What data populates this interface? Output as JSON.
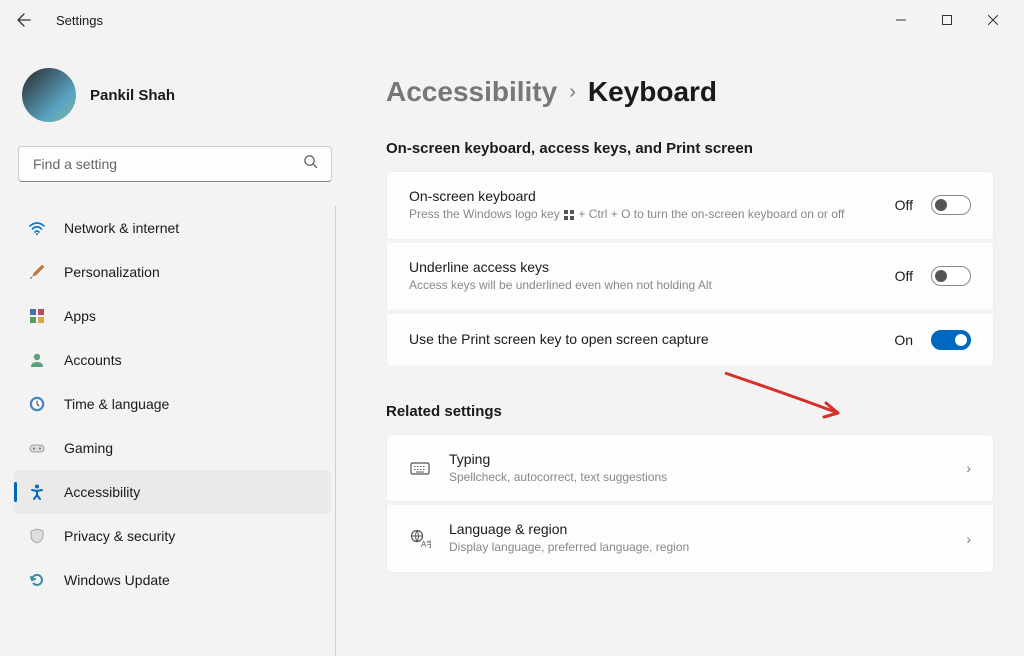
{
  "titlebar": {
    "title": "Settings"
  },
  "profile": {
    "name": "Pankil Shah"
  },
  "search": {
    "placeholder": "Find a setting"
  },
  "nav": {
    "items": [
      {
        "label": "Network & internet",
        "icon": "wifi"
      },
      {
        "label": "Personalization",
        "icon": "brush"
      },
      {
        "label": "Apps",
        "icon": "apps"
      },
      {
        "label": "Accounts",
        "icon": "person"
      },
      {
        "label": "Time & language",
        "icon": "clock"
      },
      {
        "label": "Gaming",
        "icon": "gamepad"
      },
      {
        "label": "Accessibility",
        "icon": "accessibility"
      },
      {
        "label": "Privacy & security",
        "icon": "shield"
      },
      {
        "label": "Windows Update",
        "icon": "update"
      }
    ]
  },
  "breadcrumb": {
    "parent": "Accessibility",
    "current": "Keyboard"
  },
  "section1": {
    "title": "On-screen keyboard, access keys, and Print screen",
    "items": [
      {
        "title": "On-screen keyboard",
        "sub_prefix": "Press the Windows logo key ",
        "sub_suffix": " + Ctrl + O to turn the on-screen keyboard on or off",
        "state": "Off",
        "toggle": "off"
      },
      {
        "title": "Underline access keys",
        "sub": "Access keys will be underlined even when not holding Alt",
        "state": "Off",
        "toggle": "off"
      },
      {
        "title": "Use the Print screen key to open screen capture",
        "state": "On",
        "toggle": "on"
      }
    ]
  },
  "section2": {
    "title": "Related settings",
    "items": [
      {
        "title": "Typing",
        "sub": "Spellcheck, autocorrect, text suggestions",
        "icon": "keyboard"
      },
      {
        "title": "Language & region",
        "sub": "Display language, preferred language, region",
        "icon": "language"
      }
    ]
  }
}
